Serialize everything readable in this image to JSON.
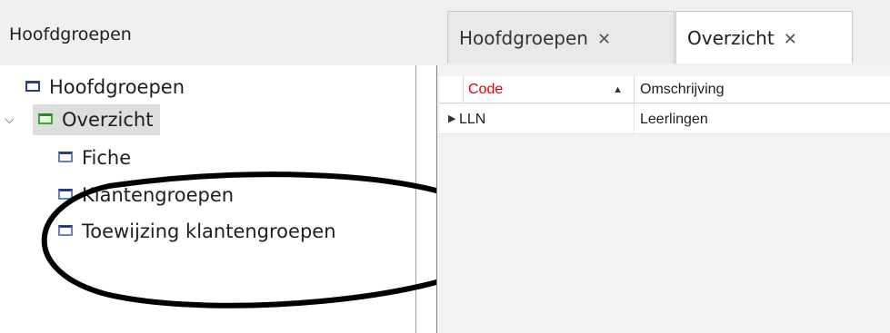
{
  "left_panel": {
    "title": "Hoofdgroepen",
    "tree": [
      {
        "label": "Hoofdgroepen"
      },
      {
        "label": "Overzicht"
      },
      {
        "label": "Fiche"
      },
      {
        "label": "Klantengroepen"
      },
      {
        "label": "Toewijzing klantengroepen"
      }
    ]
  },
  "tabs": [
    {
      "label": "Hoofdgroepen",
      "close": "✕"
    },
    {
      "label": "Overzicht",
      "close": "✕"
    }
  ],
  "grid": {
    "columns": [
      {
        "label": "Code",
        "color": "#e00000",
        "sort": "▲"
      },
      {
        "label": "Omschrijving"
      }
    ],
    "rows": [
      {
        "indicator": "▶",
        "code": "LLN",
        "omschrijving": "Leerlingen"
      }
    ]
  },
  "icons": {
    "expand": "chevron-down-icon",
    "node": "window-icon",
    "selected_node": "window-green-icon"
  }
}
